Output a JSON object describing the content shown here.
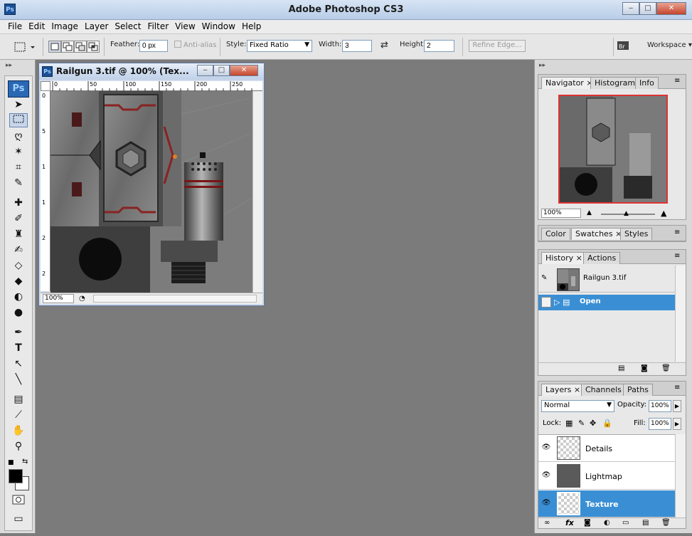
{
  "app": {
    "title": "Adobe Photoshop CS3",
    "logo": "Ps"
  },
  "window_controls": {
    "min": "‒",
    "max": "□",
    "close": "✕"
  },
  "menu": [
    "File",
    "Edit",
    "Image",
    "Layer",
    "Select",
    "Filter",
    "View",
    "Window",
    "Help"
  ],
  "options": {
    "feather_label": "Feather:",
    "feather_value": "0 px",
    "antialias_label": "Anti-alias",
    "style_label": "Style:",
    "style_value": "Fixed Ratio",
    "width_label": "Width:",
    "width_value": "3",
    "height_label": "Height:",
    "height_value": "2",
    "refine_label": "Refine Edge...",
    "workspace_label": "Workspace ▾"
  },
  "document": {
    "title": "Railgun 3.tif @ 100% (Tex...",
    "zoom": "100%",
    "ruler_top": [
      "0",
      "50",
      "100",
      "150",
      "200",
      "250"
    ],
    "ruler_left": [
      "0",
      "5",
      "1",
      "1",
      "2",
      "2"
    ]
  },
  "navigator": {
    "tabs": [
      "Navigator",
      "Histogram",
      "Info"
    ],
    "zoom": "100%"
  },
  "color_panel": {
    "tabs": [
      "Color",
      "Swatches",
      "Styles"
    ]
  },
  "history": {
    "tabs": [
      "History",
      "Actions"
    ],
    "snapshot": "Railgun 3.tif",
    "state": "Open"
  },
  "layers": {
    "tabs": [
      "Layers",
      "Channels",
      "Paths"
    ],
    "blend": "Normal",
    "opacity_label": "Opacity:",
    "opacity": "100%",
    "lock_label": "Lock:",
    "fill_label": "Fill:",
    "fill": "100%",
    "items": [
      {
        "name": "Details"
      },
      {
        "name": "Lightmap"
      },
      {
        "name": "Texture"
      }
    ]
  },
  "colors": {
    "accent": "#3a8fd4",
    "workspace": "#7b7b7b",
    "selection": "#3a8fd4"
  }
}
